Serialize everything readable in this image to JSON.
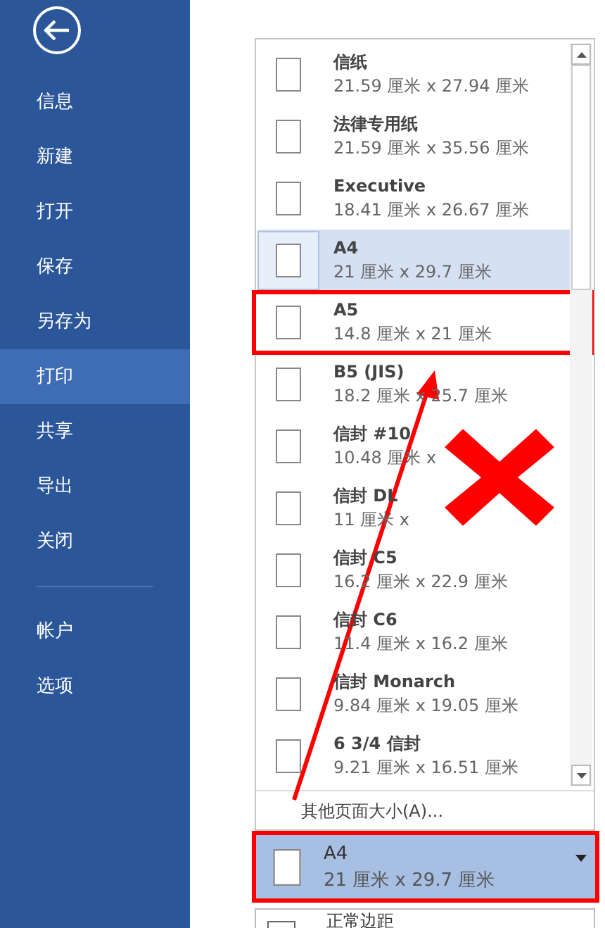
{
  "sidebar": {
    "items": [
      {
        "label": "信息",
        "selected": false
      },
      {
        "label": "新建",
        "selected": false
      },
      {
        "label": "打开",
        "selected": false
      },
      {
        "label": "保存",
        "selected": false
      },
      {
        "label": "另存为",
        "selected": false
      },
      {
        "label": "打印",
        "selected": true
      },
      {
        "label": "共享",
        "selected": false
      },
      {
        "label": "导出",
        "selected": false
      },
      {
        "label": "关闭",
        "selected": false
      }
    ],
    "footer_items": [
      {
        "label": "帐户",
        "selected": false
      },
      {
        "label": "选项",
        "selected": false
      }
    ]
  },
  "paper_sizes": [
    {
      "name": "信纸",
      "size": "21.59 厘米 x 27.94 厘米",
      "selected": false,
      "marked": false
    },
    {
      "name": "法律专用纸",
      "size": "21.59 厘米 x 35.56 厘米",
      "selected": false,
      "marked": false
    },
    {
      "name": "Executive",
      "size": "18.41 厘米 x 26.67 厘米",
      "selected": false,
      "marked": false
    },
    {
      "name": "A4",
      "size": "21 厘米 x 29.7 厘米",
      "selected": true,
      "marked": false
    },
    {
      "name": "A5",
      "size": "14.8 厘米 x 21 厘米",
      "selected": false,
      "marked": true
    },
    {
      "name": "B5 (JIS)",
      "size": "18.2 厘米 x 25.7 厘米",
      "selected": false,
      "marked": false
    },
    {
      "name": "信封 #10",
      "size": "10.48 厘米 x",
      "selected": false,
      "marked": false
    },
    {
      "name": "信封 DL",
      "size": "11 厘米 x",
      "selected": false,
      "marked": false
    },
    {
      "name": "信封 C5",
      "size": "16.2 厘米 x 22.9 厘米",
      "selected": false,
      "marked": false
    },
    {
      "name": "信封 C6",
      "size": "11.4 厘米 x 16.2 厘米",
      "selected": false,
      "marked": false
    },
    {
      "name": "信封 Monarch",
      "size": "9.84 厘米 x 19.05 厘米",
      "selected": false,
      "marked": false
    },
    {
      "name": "6 3/4 信封",
      "size": "9.21 厘米 x 16.51 厘米",
      "selected": false,
      "marked": false
    }
  ],
  "more_sizes": "其他页面大小(A)...",
  "current_size": {
    "name": "A4",
    "size": "21 厘米 x 29.7 厘米",
    "marked": true
  },
  "margins": {
    "label": "正常边距"
  }
}
